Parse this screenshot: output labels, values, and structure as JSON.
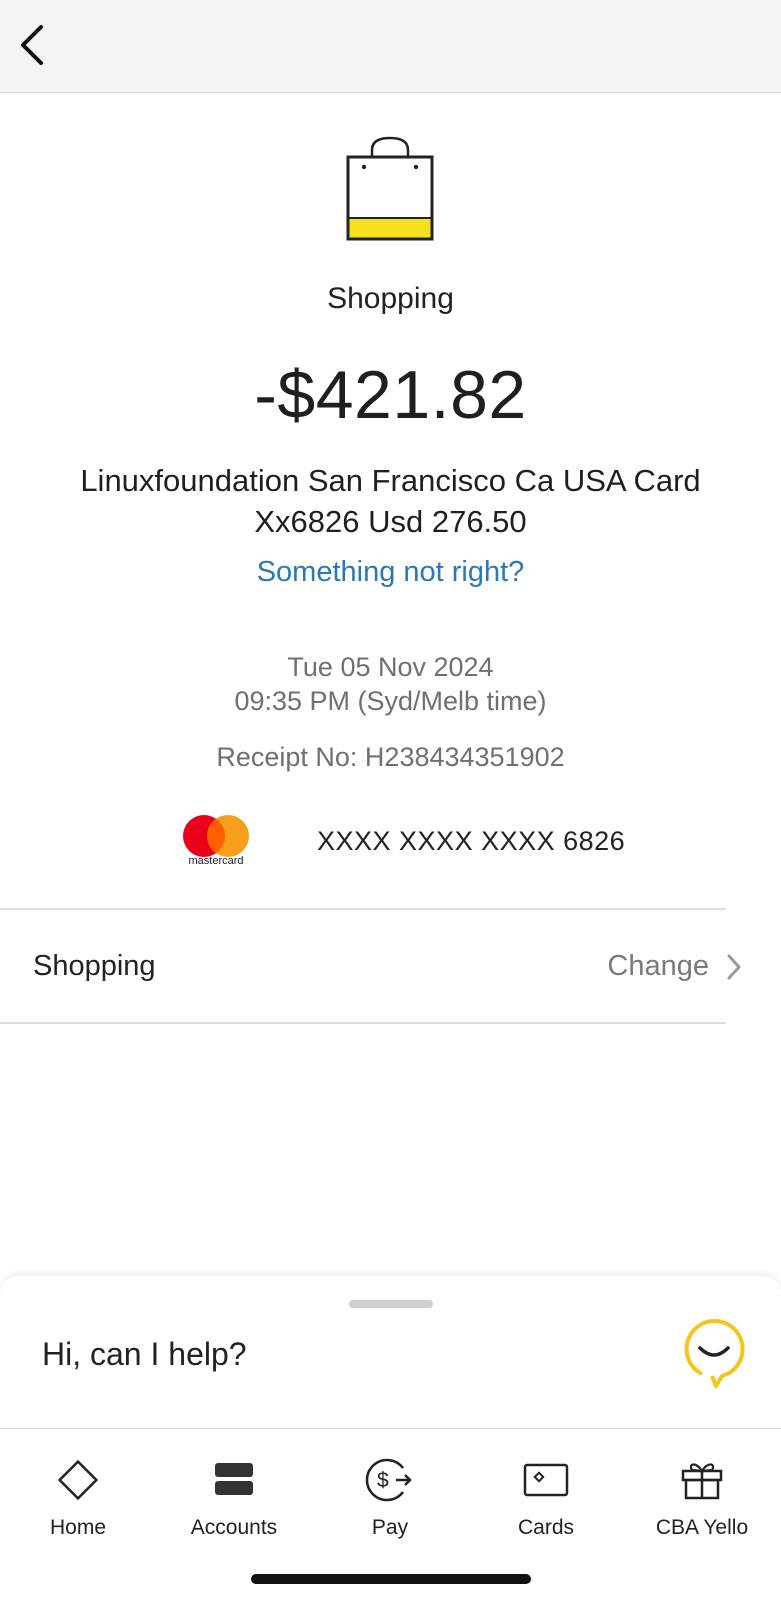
{
  "header": {
    "back_icon": "chevron-left-icon"
  },
  "transaction": {
    "category_icon": "shopping-bag-icon",
    "category": "Shopping",
    "amount": "-$421.82",
    "description": "Linuxfoundation San Francisco Ca USA Card Xx6826 Usd 276.50",
    "not_right_link": "Something not right?",
    "date": "Tue 05 Nov 2024",
    "time": "09:35 PM (Syd/Melb time)",
    "receipt": "Receipt No: H238434351902",
    "card_brand": "mastercard",
    "card_number": "XXXX XXXX XXXX 6826"
  },
  "category_row": {
    "label": "Shopping",
    "action": "Change"
  },
  "help": {
    "text": "Hi, can I help?"
  },
  "tabs": [
    {
      "label": "Home",
      "icon": "home-diamond-icon"
    },
    {
      "label": "Accounts",
      "icon": "accounts-icon"
    },
    {
      "label": "Pay",
      "icon": "pay-icon"
    },
    {
      "label": "Cards",
      "icon": "card-icon"
    },
    {
      "label": "CBA Yello",
      "icon": "gift-icon"
    }
  ],
  "colors": {
    "accent_yellow": "#ffcc00",
    "link_blue": "#2a78b8",
    "mc_red": "#eb001b",
    "mc_orange": "#f79e1b"
  }
}
